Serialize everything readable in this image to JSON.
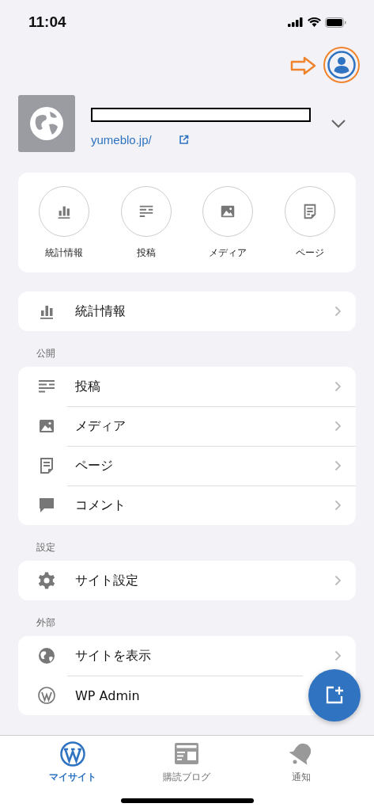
{
  "status_bar": {
    "time": "11:04"
  },
  "site": {
    "url": "yumeblo.jp/"
  },
  "quick_actions": [
    {
      "kind": "stats",
      "label": "統計情報"
    },
    {
      "kind": "posts",
      "label": "投稿"
    },
    {
      "kind": "media",
      "label": "メディア"
    },
    {
      "kind": "page",
      "label": "ページ"
    }
  ],
  "sections": [
    {
      "items": [
        {
          "kind": "stats",
          "label": "統計情報"
        }
      ]
    },
    {
      "header": "公開",
      "items": [
        {
          "kind": "posts",
          "label": "投稿"
        },
        {
          "kind": "media",
          "label": "メディア"
        },
        {
          "kind": "page",
          "label": "ページ"
        },
        {
          "kind": "comment",
          "label": "コメント"
        }
      ]
    },
    {
      "header": "設定",
      "items": [
        {
          "kind": "settings",
          "label": "サイト設定"
        }
      ]
    },
    {
      "header": "外部",
      "items": [
        {
          "kind": "globe",
          "label": "サイトを表示"
        },
        {
          "kind": "wordpress",
          "label": "WP Admin"
        }
      ]
    }
  ],
  "tabs": [
    {
      "kind": "wordpress",
      "label": "マイサイト",
      "selected": true
    },
    {
      "kind": "reader",
      "label": "購読ブログ",
      "selected": false
    },
    {
      "kind": "bell",
      "label": "通知",
      "selected": false
    }
  ]
}
